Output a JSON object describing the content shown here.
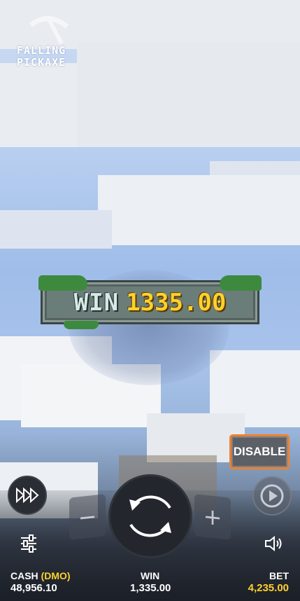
{
  "logo": {
    "line1": "FALLING",
    "line2": "PICKAXE",
    "icon": "pickaxe-icon"
  },
  "win_banner": {
    "label": "WIN",
    "amount": "1335.00"
  },
  "controls": {
    "disable_label": "DISABLE",
    "minus_label": "−",
    "plus_label": "+",
    "turbo_icon": "fast-forward-icon",
    "spin_icon": "spin-arrows-icon",
    "autoplay_icon": "autoplay-icon",
    "settings_icon": "sliders-icon",
    "sound_icon": "speaker-icon"
  },
  "status_bar": {
    "cash_label": "CASH",
    "cash_mode": "(DMO)",
    "cash_value": "48,956.10",
    "win_label": "WIN",
    "win_value": "1,335.00",
    "bet_label": "BET",
    "bet_value": "4,235.00"
  },
  "colors": {
    "accent_gold": "#ffd12e",
    "disable_border": "#f0812b",
    "banner_stone": "#6b7d78"
  }
}
